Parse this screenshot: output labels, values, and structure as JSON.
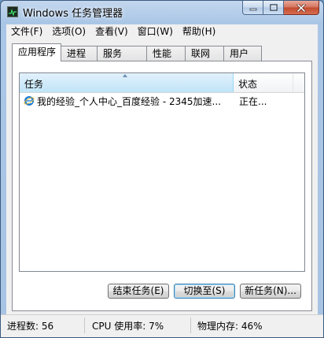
{
  "window": {
    "title": "Windows 任务管理器"
  },
  "menu": [
    "文件(F)",
    "选项(O)",
    "查看(V)",
    "窗口(W)",
    "帮助(H)"
  ],
  "tabs": [
    "应用程序",
    "进程",
    "服务",
    "性能",
    "联网",
    "用户"
  ],
  "active_tab": "应用程序",
  "columns": {
    "task": "任务",
    "status": "状态"
  },
  "rows": [
    {
      "task": "我的经验_个人中心_百度经验 - 2345加速...",
      "status": "正在...",
      "icon": "ie-icon"
    }
  ],
  "buttons": {
    "end_task": "结束任务(E)",
    "switch_to": "切换至(S)",
    "new_task": "新任务(N)..."
  },
  "status_bar": {
    "processes": "进程数: 56",
    "cpu": "CPU 使用率: 7%",
    "memory": "物理内存: 46%"
  },
  "colors": {
    "title_glass": "#aac6e6",
    "ie_blue": "#1e7bd1",
    "close_red": "#c04a2e"
  }
}
